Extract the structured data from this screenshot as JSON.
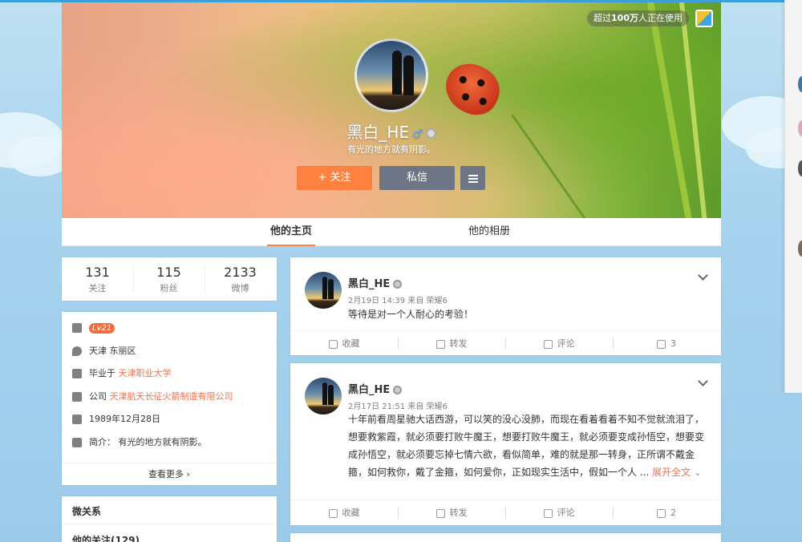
{
  "cover": {
    "users_badge_prefix": "超过",
    "users_badge_count": "100万",
    "users_badge_suffix": "人正在使用",
    "username": "黑白_HE",
    "gender_symbol": "♂",
    "tagline": "有光的地方就有阴影。",
    "follow_label": "+ 关注",
    "message_label": "私信"
  },
  "tabs": [
    {
      "label": "他的主页",
      "active": true
    },
    {
      "label": "他的相册",
      "active": false
    }
  ],
  "stats": [
    {
      "value": "131",
      "label": "关注"
    },
    {
      "value": "115",
      "label": "粉丝"
    },
    {
      "value": "2133",
      "label": "微博"
    }
  ],
  "info": {
    "level": "Lv21",
    "location": "天津 东丽区",
    "school_prefix": "毕业于 ",
    "school": "天津职业大学",
    "company_prefix": "公司 ",
    "company": "天津航天长征火箭制造有限公司",
    "birthday": "1989年12月28日",
    "bio": "简介：  有光的地方就有阴影。",
    "see_more": "查看更多 ›"
  },
  "relation": {
    "title": "微关系",
    "following": "他的关注(129)"
  },
  "posts": [
    {
      "name": "黑白_HE",
      "meta": "2月19日 14:39 来自 荣耀6",
      "text": "等待是对一个人耐心的考验！",
      "expand": "",
      "actions": [
        "收藏",
        "转发",
        "评论",
        "3"
      ]
    },
    {
      "name": "黑白_HE",
      "meta": "2月17日 21:51 来自 荣耀6",
      "text": "十年前看周星驰大话西游，可以笑的没心没肺，而现在看着看着不知不觉就流泪了，想要救紫霞，就必须要打败牛魔王，想要打败牛魔王，就必须要变成孙悟空，想要变成孙悟空，就必须要忘掉七情六欲，看似简单，难的就是那一转身，正所谓不戴金箍，如何救你，戴了金箍，如何爱你，正如现实生活中，假如一个人 ... ",
      "expand": "展开全文 ⌄",
      "actions": [
        "收藏",
        "转发",
        "评论",
        "2"
      ]
    }
  ],
  "colors": {
    "accent": "#ff8140",
    "link": "#eb7350",
    "button_gray": "#6e7685"
  }
}
